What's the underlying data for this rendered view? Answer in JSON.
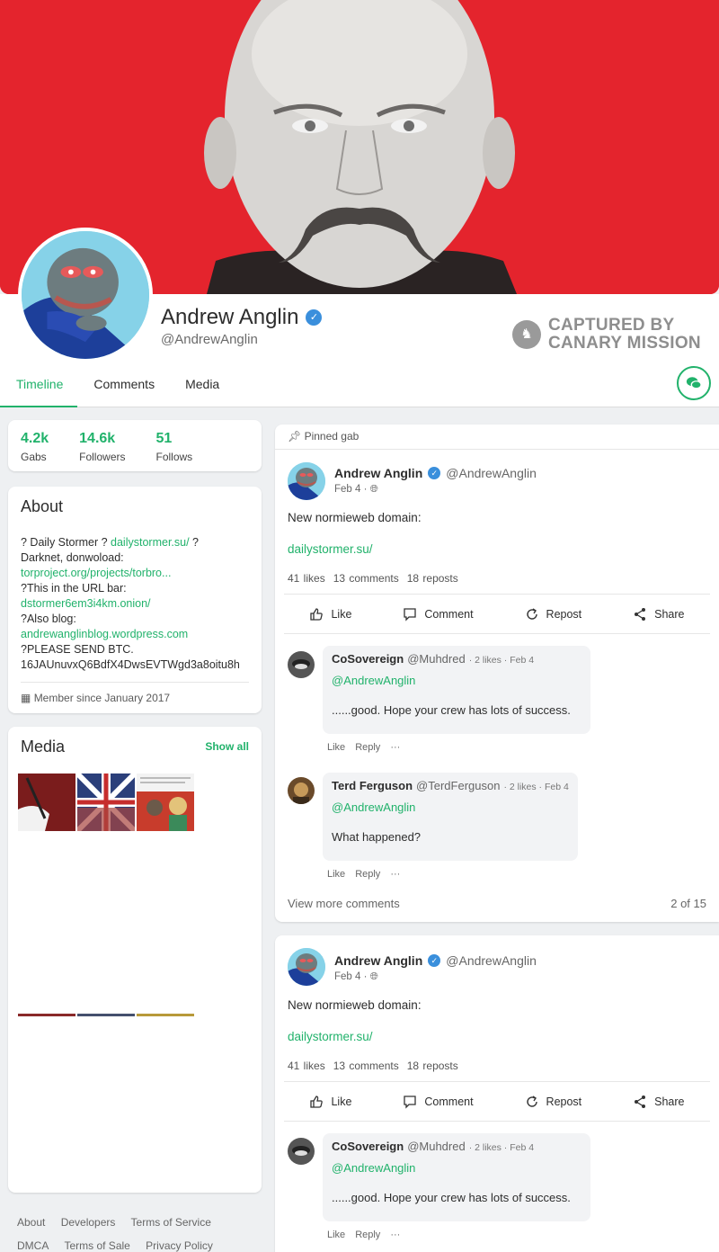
{
  "profile": {
    "display_name": "Andrew Anglin",
    "handle": "@AndrewAnglin",
    "watermark_line1": "CAPTURED BY",
    "watermark_line2": "CANARY MISSION"
  },
  "tabs": [
    {
      "label": "Timeline",
      "active": true
    },
    {
      "label": "Comments",
      "active": false
    },
    {
      "label": "Media",
      "active": false
    }
  ],
  "stats": [
    {
      "value": "4.2k",
      "label": "Gabs"
    },
    {
      "value": "14.6k",
      "label": "Followers"
    },
    {
      "value": "51",
      "label": "Follows"
    }
  ],
  "about": {
    "title": "About",
    "line1_a": "? Daily Stormer ? ",
    "line1_link": "dailystormer.su/",
    "line1_b": " ?",
    "line2": "Darknet, donwoload:",
    "line3_link": "torproject.org/projects/torbro...",
    "line4": "?This in the URL bar:",
    "line5_link": "dstormer6em3i4km.onion/",
    "line6": "?Also blog:",
    "line7_link": "andrewanglinblog.wordpress.com",
    "line8": "?PLEASE SEND BTC.",
    "line9": "16JAUnuvxQ6BdfX4DwsEVTWgd3a8oitu8h",
    "member_since": "Member since January 2017"
  },
  "media": {
    "title": "Media",
    "show_all": "Show all"
  },
  "footer": {
    "row1": [
      "About",
      "Developers",
      "Terms of Service"
    ],
    "row2": [
      "DMCA",
      "Terms of Sale",
      "Privacy Policy"
    ]
  },
  "post1": {
    "pinned": "Pinned gab",
    "author": "Andrew Anglin",
    "handle": "@AndrewAnglin",
    "date": "Feb 4 ·",
    "body": "New normieweb domain:",
    "link": "dailystormer.su/",
    "likes": "41 likes",
    "comments": "13 comments",
    "reposts": "18 reposts",
    "actions": {
      "like": "Like",
      "comment": "Comment",
      "repost": "Repost",
      "share": "Share"
    },
    "comment1": {
      "name": "CoSovereign",
      "handle": "@Muhdred",
      "meta": "· 2 likes · Feb 4",
      "mention": "@AndrewAnglin",
      "text": "......good. Hope your crew has lots of success.",
      "like": "Like",
      "reply": "Reply",
      "more": "···"
    },
    "comment2": {
      "name": "Terd Ferguson",
      "handle": "@TerdFerguson",
      "meta": "· 2 likes · Feb 4",
      "mention": "@AndrewAnglin",
      "text": "What happened?",
      "like": "Like",
      "reply": "Reply",
      "more": "···"
    },
    "view_more": "View more comments",
    "page_count": "2 of 15"
  },
  "post2": {
    "author": "Andrew Anglin",
    "handle": "@AndrewAnglin",
    "date": "Feb 4 ·",
    "body": "New normieweb domain:",
    "link": "dailystormer.su/",
    "likes": "41 likes",
    "comments": "13 comments",
    "reposts": "18 reposts",
    "actions": {
      "like": "Like",
      "comment": "Comment",
      "repost": "Repost",
      "share": "Share"
    },
    "comment1": {
      "name": "CoSovereign",
      "handle": "@Muhdred",
      "meta": "· 2 likes · Feb 4",
      "mention": "@AndrewAnglin",
      "text": "......good. Hope your crew has lots of success.",
      "like": "Like",
      "reply": "Reply",
      "more": "···"
    }
  },
  "colors": {
    "accent": "#21b26b",
    "cover": "#e4242d",
    "verified": "#3a8fdc"
  }
}
